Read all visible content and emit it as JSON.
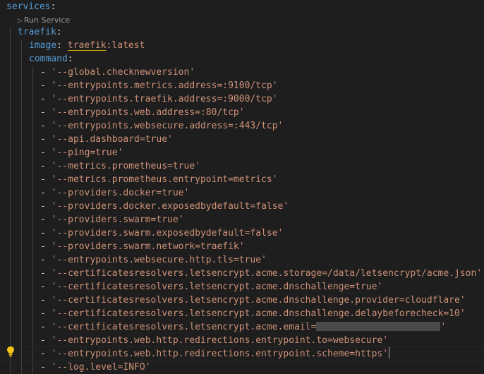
{
  "yaml": {
    "services_key": "services",
    "run_service_label": "Run Service",
    "traefik_key": "traefik",
    "image_key": "image",
    "image_name": "traefik",
    "image_tag": ":latest",
    "command_key": "command",
    "colon": ":",
    "commands": [
      "'--global.checknewversion'",
      "'--entrypoints.metrics.address=:9100/tcp'",
      "'--entrypoints.traefik.address=:9000/tcp'",
      "'--entrypoints.web.address=:80/tcp'",
      "'--entrypoints.websecure.address=:443/tcp'",
      "'--api.dashboard=true'",
      "'--ping=true'",
      "'--metrics.prometheus=true'",
      "'--metrics.prometheus.entrypoint=metrics'",
      "'--providers.docker=true'",
      "'--providers.docker.exposedbydefault=false'",
      "'--providers.swarm=true'",
      "'--providers.swarm.exposedbydefault=false'",
      "'--providers.swarm.network=traefik'",
      "'--entrypoints.websecure.http.tls=true'",
      "'--certificatesresolvers.letsencrypt.acme.storage=/data/letsencrypt/acme.json'",
      "'--certificatesresolvers.letsencrypt.acme.dnschallenge=true'",
      "'--certificatesresolvers.letsencrypt.acme.dnschallenge.provider=cloudflare'",
      "'--certificatesresolvers.letsencrypt.acme.dnschallenge.delaybeforecheck=10'",
      "'--certificatesresolvers.letsencrypt.acme.email=",
      "'--entrypoints.web.http.redirections.entrypoint.to=websecure'",
      "'--entrypoints.web.http.redirections.entrypoint.scheme=https'",
      "'--log.level=INFO'"
    ],
    "email_closing_quote": "'",
    "dash": "- "
  },
  "icons": {
    "run": "play-triangle-icon",
    "lightbulb": "lightbulb-icon"
  },
  "colors": {
    "background": "#1e1e1e",
    "key": "#569cd6",
    "string": "#ce9178",
    "guide": "#404040",
    "lightbulb": "#f5c518"
  }
}
